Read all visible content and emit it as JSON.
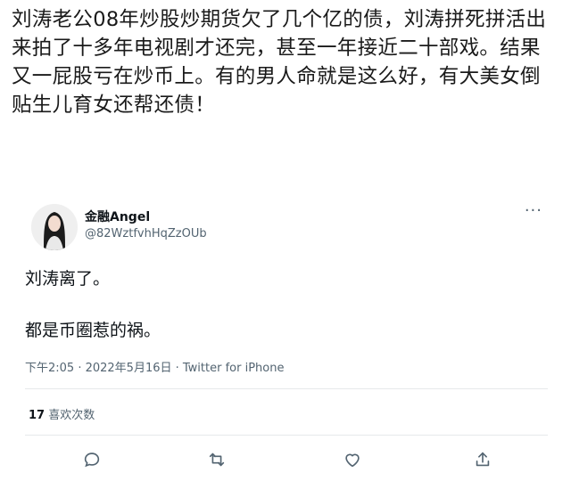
{
  "post": {
    "text": "刘涛老公08年炒股炒期货欠了几个亿的债，刘涛拼死拼活出来拍了十多年电视剧才还完，甚至一年接近二十部戏。结果又一屁股亏在炒币上。有的男人命就是这么好，有大美女倒贴生儿育女还帮还债！"
  },
  "tweet": {
    "author_name": "金融Angel",
    "author_handle": "@82WztfvhHqZzOUb",
    "more_icon": "more-horizontal-icon",
    "lines": [
      "刘涛离了。",
      "都是币圈惹的祸。"
    ],
    "timestamp": "下午2:05 · 2022年5月16日 · Twitter for iPhone",
    "likes_count": "17",
    "likes_label": "喜欢次数",
    "actions": [
      "reply-icon",
      "retweet-icon",
      "like-icon",
      "share-icon"
    ],
    "colors": {
      "text": "#0f1419",
      "secondary": "#536471",
      "divider": "#e6e9eb"
    }
  }
}
